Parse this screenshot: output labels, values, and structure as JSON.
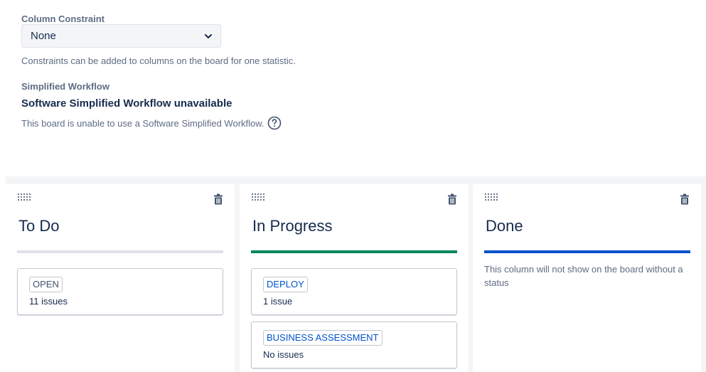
{
  "column_constraint": {
    "label": "Column Constraint",
    "selected": "None",
    "help": "Constraints can be added to columns on the board for one statistic."
  },
  "simplified_workflow": {
    "label": "Simplified Workflow",
    "title": "Software Simplified Workflow unavailable",
    "help": "This board is unable to use a Software Simplified Workflow."
  },
  "colors": {
    "todo_bar": "#dfe1e6",
    "inprogress_bar": "#00875a",
    "done_bar": "#0052cc",
    "todo_lozenge": "#42526e",
    "inprogress_lozenge": "#0052cc"
  },
  "columns": [
    {
      "title": "To Do",
      "statuses": [
        {
          "name": "OPEN",
          "count": "11 issues"
        }
      ]
    },
    {
      "title": "In Progress",
      "statuses": [
        {
          "name": "DEPLOY",
          "count": "1 issue"
        },
        {
          "name": "BUSINESS ASSESSMENT",
          "count": "No issues"
        }
      ]
    },
    {
      "title": "Done",
      "empty_message": "This column will not show on the board without a status"
    }
  ]
}
